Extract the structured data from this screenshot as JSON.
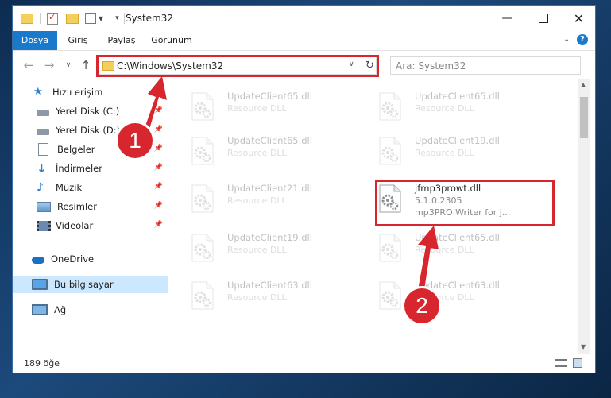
{
  "window": {
    "title": "System32"
  },
  "ribbon": {
    "tabs": [
      {
        "label": "Dosya",
        "active": true
      },
      {
        "label": "Giriş"
      },
      {
        "label": "Paylaş"
      },
      {
        "label": "Görünüm"
      }
    ]
  },
  "address": {
    "path": "C:\\Windows\\System32"
  },
  "search": {
    "placeholder": "Ara: System32"
  },
  "sidebar": {
    "items": [
      {
        "label": "Hızlı erişim",
        "icon": "star-icon"
      },
      {
        "label": "Yerel Disk (C:)",
        "icon": "drive-icon",
        "pinned": true
      },
      {
        "label": "Yerel Disk (D:)",
        "icon": "drive-icon",
        "pinned": true
      },
      {
        "label": "Belgeler",
        "icon": "documents-icon",
        "pinned": true
      },
      {
        "label": "İndirmeler",
        "icon": "download-icon",
        "pinned": true
      },
      {
        "label": "Müzik",
        "icon": "music-icon",
        "pinned": true
      },
      {
        "label": "Resimler",
        "icon": "pictures-icon",
        "pinned": true
      },
      {
        "label": "Videolar",
        "icon": "videos-icon",
        "pinned": true
      },
      {
        "label": "OneDrive",
        "icon": "cloud-icon"
      },
      {
        "label": "Bu bilgisayar",
        "icon": "computer-icon",
        "selected": true
      },
      {
        "label": "Ağ",
        "icon": "network-icon"
      }
    ]
  },
  "files": [
    {
      "name": "UpdateClient65.dll",
      "type": "Resource DLL"
    },
    {
      "name": "UpdateClient65.dll",
      "type": "Resource DLL"
    },
    {
      "name": "UpdateClient65.dll",
      "type": "Resource DLL"
    },
    {
      "name": "UpdateClient19.dll",
      "type": "Resource DLL"
    },
    {
      "name": "UpdateClient21.dll",
      "type": "Resource DLL"
    },
    {
      "name": "jfmp3prowt.dll",
      "version": "5.1.0.2305",
      "description": "mp3PRO Writer for j..."
    },
    {
      "name": "UpdateClient19.dll",
      "type": "Resource DLL"
    },
    {
      "name": "UpdateClient65.dll",
      "type": "Resource DLL"
    },
    {
      "name": "UpdateClient63.dll",
      "type": "Resource DLL"
    },
    {
      "name": "UpdateClient63.dll",
      "type": "Resource DLL"
    }
  ],
  "status": {
    "item_count": "189 öğe"
  },
  "annotations": {
    "step1": "1",
    "step2": "2",
    "color": "#d8262f"
  }
}
